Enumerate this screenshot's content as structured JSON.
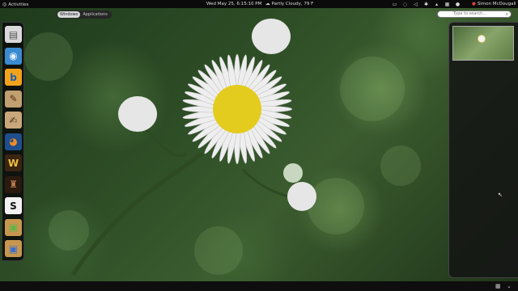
{
  "topbar": {
    "activities_label": "Activities",
    "clock": "Wed May 25,  6:15:10 PM",
    "weather": "Partly Cloudy, 79 F",
    "user_name": "Simon McDougall"
  },
  "overview": {
    "tabs": [
      {
        "label": "Windows",
        "active": true
      },
      {
        "label": "Applications",
        "active": false
      }
    ],
    "search_placeholder": "Type to search..."
  },
  "dash": {
    "items": [
      {
        "icon": "file-manager-icon",
        "glyph": "▤",
        "bg": "#d9d9d9",
        "color": "#555"
      },
      {
        "icon": "browser-icon",
        "glyph": "◉",
        "bg": "#3b8bd0",
        "color": "#e8f2ff"
      },
      {
        "icon": "bluefish-icon",
        "glyph": "b",
        "bg": "#f2a21b",
        "color": "#1b5fb7"
      },
      {
        "icon": "paint-icon",
        "glyph": "✎",
        "bg": "#c0a070",
        "color": "#5b2c14"
      },
      {
        "icon": "text-editor-icon",
        "glyph": "✍",
        "bg": "#c9a77a",
        "color": "#4a3520"
      },
      {
        "icon": "blender-icon",
        "glyph": "◕",
        "bg": "#1f4e8c",
        "color": "#f08a24"
      },
      {
        "icon": "world-of-warcraft-icon",
        "glyph": "W",
        "bg": "#3a2412",
        "color": "#f0c040"
      },
      {
        "icon": "game-icon",
        "glyph": "♜",
        "bg": "#2a1a10",
        "color": "#c08050"
      },
      {
        "icon": "steam-icon",
        "glyph": "S",
        "bg": "#f2f2f2",
        "color": "#111"
      },
      {
        "icon": "package-installer-icon",
        "glyph": "▣",
        "bg": "#c8974f",
        "color": "#5fb54a"
      },
      {
        "icon": "package-manager-icon",
        "glyph": "▣",
        "bg": "#c8974f",
        "color": "#3a6fd0"
      }
    ]
  }
}
